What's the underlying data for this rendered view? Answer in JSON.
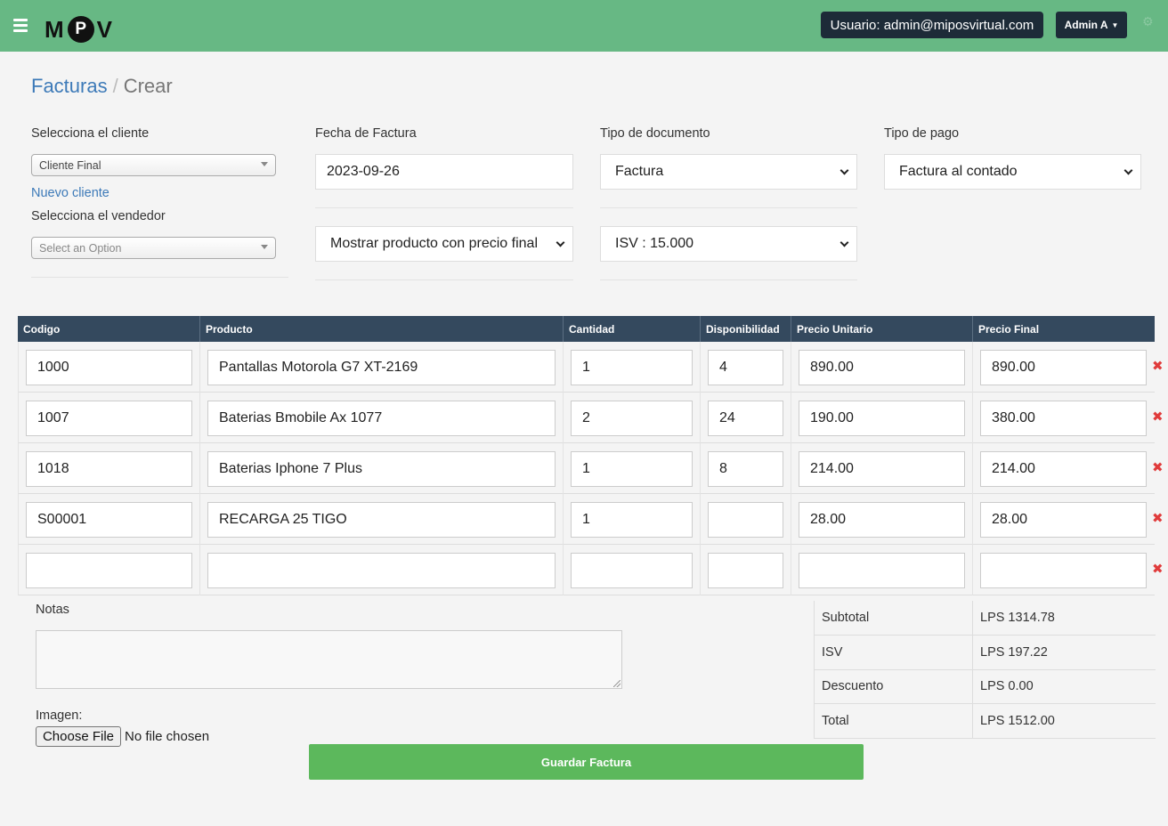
{
  "header": {
    "logo": {
      "left": "M",
      "circle": "P",
      "right": "V"
    },
    "user_label": "Usuario: admin@miposvirtual.com",
    "admin_label": "Admin A"
  },
  "breadcrumb": {
    "section": "Facturas",
    "separator": "/",
    "current": "Crear"
  },
  "form": {
    "cliente_label": "Selecciona el cliente",
    "cliente_value": "Cliente Final",
    "nuevo_cliente": "Nuevo cliente",
    "vendedor_label": "Selecciona el vendedor",
    "vendedor_placeholder": "Select an Option",
    "fecha_label": "Fecha de Factura",
    "fecha_value": "2023-09-26",
    "tipo_doc_label": "Tipo de documento",
    "tipo_doc_value": "Factura",
    "tipo_pago_label": "Tipo de pago",
    "tipo_pago_value": "Factura al contado",
    "mostrar_value": "Mostrar producto con precio final",
    "isv_value": "ISV : 15.000"
  },
  "table": {
    "headers": [
      "Codigo",
      "Producto",
      "Cantidad",
      "Disponibilidad",
      "Precio Unitario",
      "Precio Final"
    ],
    "rows": [
      {
        "codigo": "1000",
        "producto": "Pantallas Motorola  G7 XT-2169",
        "cantidad": "1",
        "disponibilidad": "4",
        "precio_unitario": "890.00",
        "precio_final": "890.00"
      },
      {
        "codigo": "1007",
        "producto": "Baterias  Bmobile  Ax 1077",
        "cantidad": "2",
        "disponibilidad": "24",
        "precio_unitario": "190.00",
        "precio_final": "380.00"
      },
      {
        "codigo": "1018",
        "producto": "Baterias  Iphone 7 Plus",
        "cantidad": "1",
        "disponibilidad": "8",
        "precio_unitario": "214.00",
        "precio_final": "214.00"
      },
      {
        "codigo": "S00001",
        "producto": "RECARGA 25 TIGO",
        "cantidad": "1",
        "disponibilidad": "",
        "precio_unitario": "28.00",
        "precio_final": "28.00"
      },
      {
        "codigo": "",
        "producto": "",
        "cantidad": "",
        "disponibilidad": "",
        "precio_unitario": "",
        "precio_final": ""
      }
    ]
  },
  "notes": {
    "label": "Notas",
    "value": ""
  },
  "image": {
    "label": "Imagen:",
    "button": "Choose File",
    "status": "No file chosen"
  },
  "totals": [
    {
      "label": "Subtotal",
      "value": "LPS 1314.78"
    },
    {
      "label": "ISV",
      "value": "LPS 197.22"
    },
    {
      "label": "Descuento",
      "value": "LPS 0.00"
    },
    {
      "label": "Total",
      "value": "LPS 1512.00"
    }
  ],
  "save_button": "Guardar Factura",
  "icons": {
    "menu": "hamburger-icon",
    "caret": "caret-down-icon",
    "settings": "gear-icon",
    "delete": "delete-row-icon",
    "dropdown": "chevron-down-icon"
  },
  "colors": {
    "topbar": "#67b884",
    "dark": "#1d2b38",
    "table_header": "#34495e",
    "link": "#3d7ab8",
    "save": "#5cb85c",
    "delete": "#e03b3b"
  }
}
